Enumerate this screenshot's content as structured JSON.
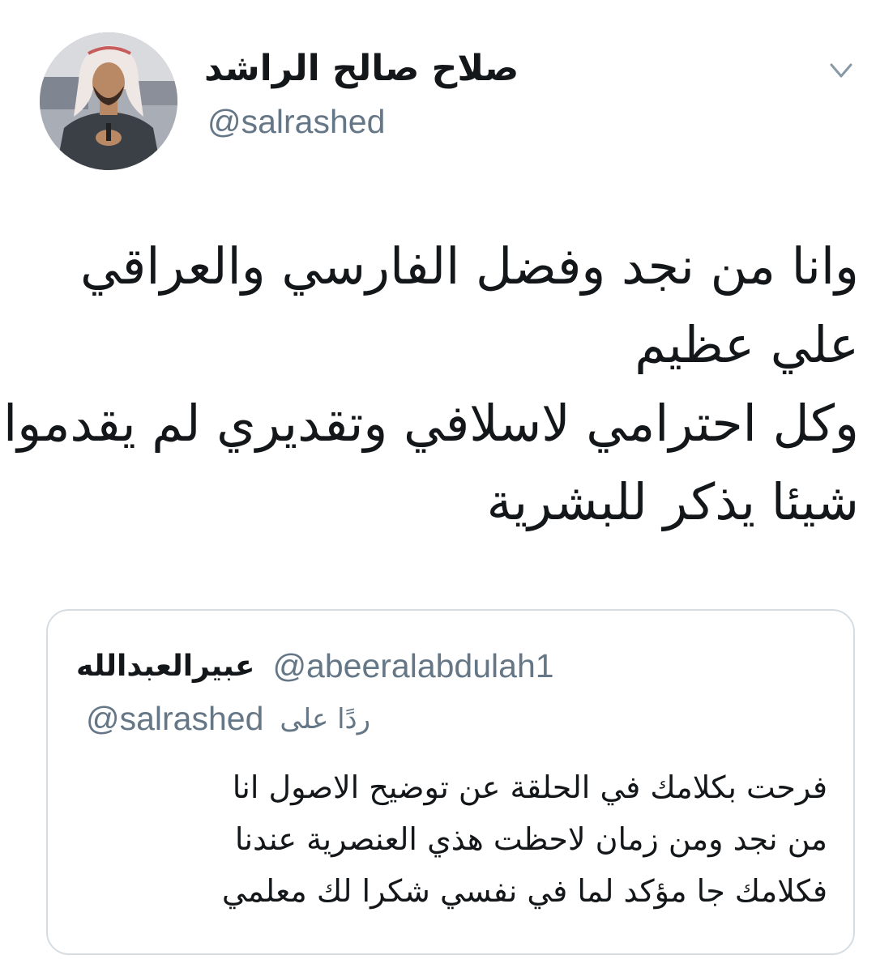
{
  "tweet": {
    "author": {
      "display_name": "صلاح صالح الراشد",
      "handle": "@salrashed",
      "avatar_icon": "profile-photo"
    },
    "menu_icon": "chevron-down-icon",
    "text_lines": [
      "وانا من نجد وفضل الفارسي والعراقي",
      "علي عظيم",
      "وكل احترامي لاسلافي وتقديري لم يقدموا",
      "شيئا يذكر للبشرية"
    ]
  },
  "quoted_tweet": {
    "author": {
      "display_name": "عبيرالعبدالله",
      "handle": "@abeeralabdulah1"
    },
    "reply_prefix": "ردًا على",
    "reply_to": "@salrashed",
    "text_lines": [
      "فرحت بكلامك في الحلقة عن توضيح الاصول انا",
      "من نجد ومن زمان لاحظت هذي العنصرية عندنا",
      "فكلامك جا مؤكد لما في نفسي شكرا لك معلمي"
    ]
  },
  "colors": {
    "text_primary": "#14171a",
    "text_secondary": "#657786",
    "card_border": "#d5dde3",
    "background": "#ffffff"
  }
}
